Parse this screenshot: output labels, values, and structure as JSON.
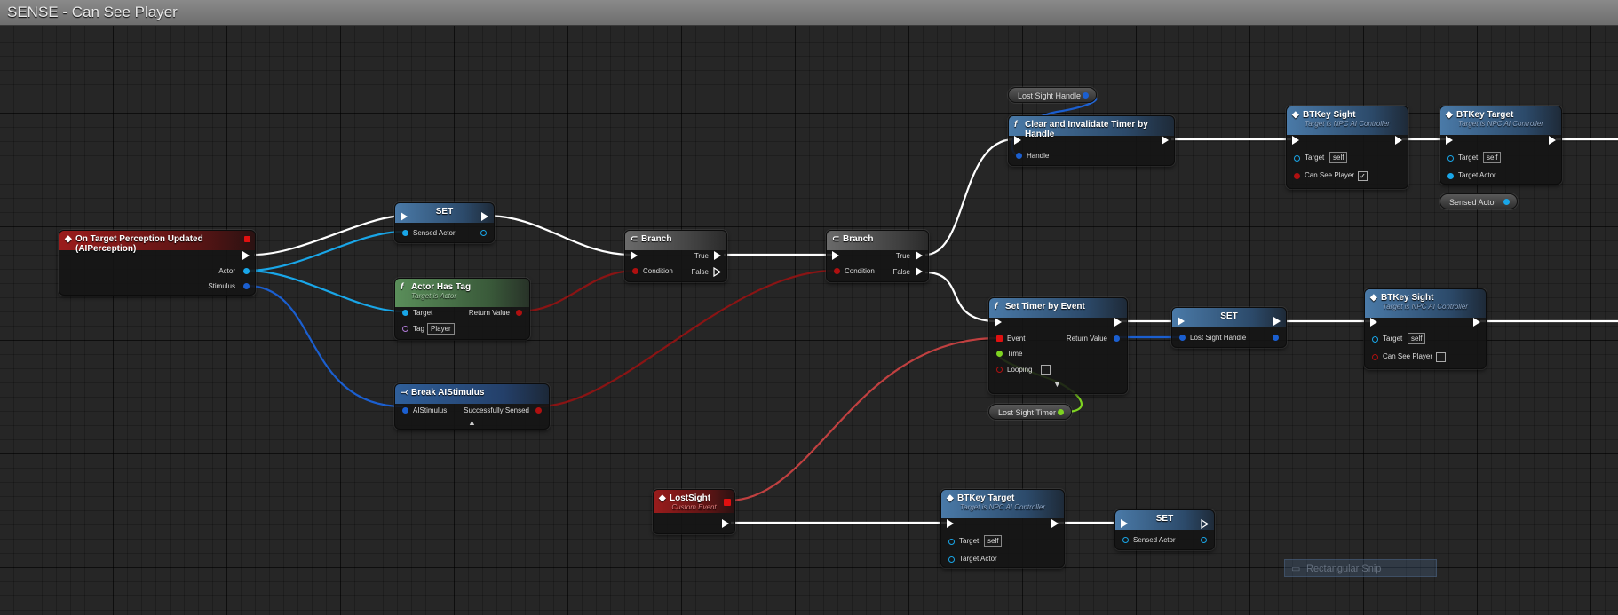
{
  "window": {
    "title": "SENSE - Can See Player"
  },
  "colors": {
    "exec": "#ffffff",
    "object": "#19a6e8",
    "bool": "#b01010",
    "struct": "#1b5fd0",
    "float": "#7ed321",
    "name": "#b07ad6"
  },
  "nodes": {
    "on_target": {
      "title": "On Target Perception Updated (AIPerception)",
      "pin_actor": "Actor",
      "pin_stimulus": "Stimulus"
    },
    "set1": {
      "title": "SET",
      "pin": "Sensed Actor"
    },
    "actor_has_tag": {
      "title": "Actor Has Tag",
      "subtitle": "Target is Actor",
      "pin_target": "Target",
      "pin_return": "Return Value",
      "pin_tag": "Tag",
      "tag_value": "Player"
    },
    "break_stimulus": {
      "title": "Break AIStimulus",
      "pin_in": "AIStimulus",
      "pin_out": "Successfully Sensed"
    },
    "branch1": {
      "title": "Branch",
      "true": "True",
      "false": "False",
      "condition": "Condition"
    },
    "branch2": {
      "title": "Branch",
      "true": "True",
      "false": "False",
      "condition": "Condition"
    },
    "lost_sight_handle_var": {
      "label": "Lost Sight Handle"
    },
    "clear_timer": {
      "title": "Clear and Invalidate Timer by Handle",
      "pin": "Handle"
    },
    "btkey_sight1": {
      "title": "BTKey Sight",
      "subtitle": "Target is NPC AI Controller",
      "pin_target": "Target",
      "target_value": "self",
      "pin_can_see": "Can See Player",
      "checked": "✓"
    },
    "btkey_target1": {
      "title": "BTKey Target",
      "subtitle": "Target is NPC AI Controller",
      "pin_target": "Target",
      "target_value": "self",
      "pin_actor": "Target Actor"
    },
    "sensed_actor_var": {
      "label": "Sensed Actor"
    },
    "set_timer": {
      "title": "Set Timer by Event",
      "pin_event": "Event",
      "pin_time": "Time",
      "pin_looping": "Looping",
      "pin_return": "Return Value",
      "expand": "▼"
    },
    "lost_sight_timer_var": {
      "label": "Lost Sight Timer"
    },
    "set2": {
      "title": "SET",
      "pin": "Lost Sight Handle"
    },
    "btkey_sight2": {
      "title": "BTKey Sight",
      "subtitle": "Target is NPC AI Controller",
      "pin_target": "Target",
      "target_value": "self",
      "pin_can_see": "Can See Player"
    },
    "lost_sight_event": {
      "title": "LostSight",
      "subtitle": "Custom Event"
    },
    "btkey_target2": {
      "title": "BTKey Target",
      "subtitle": "Target is NPC AI Controller",
      "pin_target": "Target",
      "target_value": "self",
      "pin_actor": "Target Actor"
    },
    "set3": {
      "title": "SET",
      "pin": "Sensed Actor"
    }
  },
  "overlay": {
    "rectangular_snip": "Rectangular Snip"
  }
}
